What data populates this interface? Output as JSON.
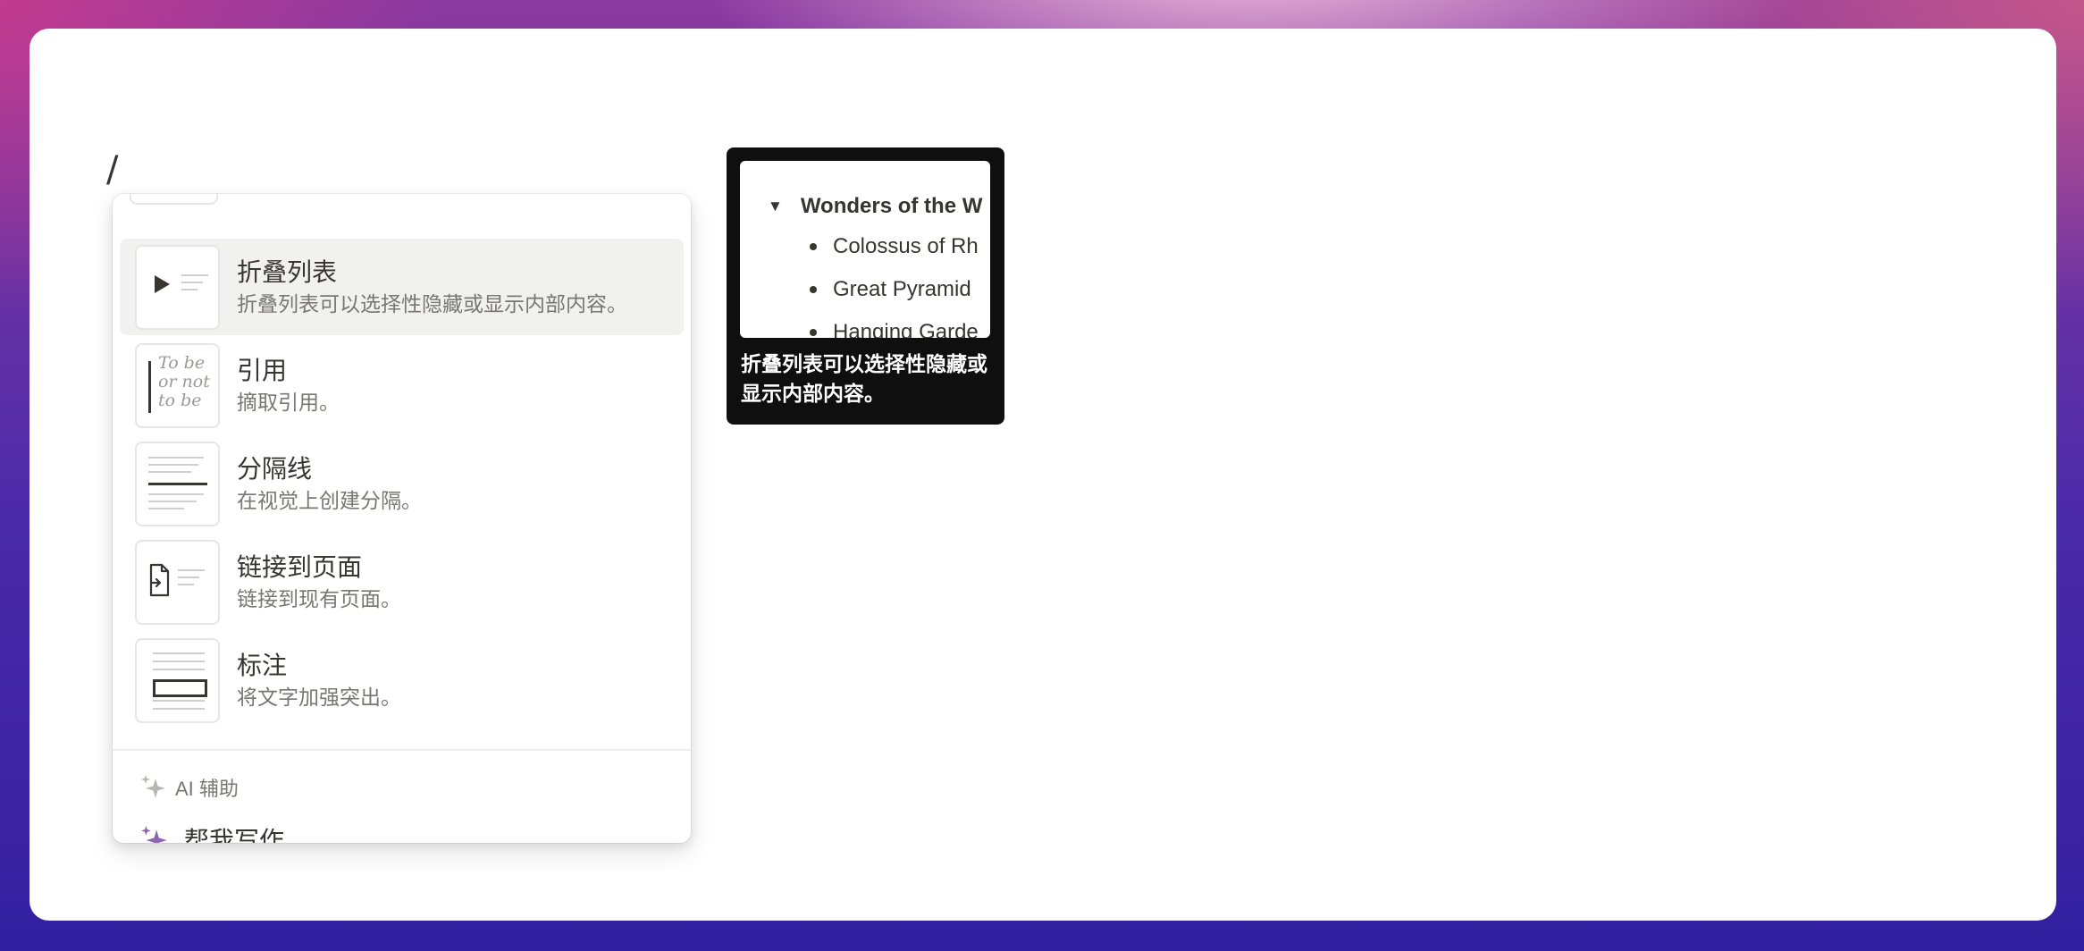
{
  "editor": {
    "typed_text": "/"
  },
  "menu": {
    "items": [
      {
        "title": "折叠列表",
        "description": "折叠列表可以选择性隐藏或显示内部内容。",
        "icon": "toggle-list-icon"
      },
      {
        "title": "引用",
        "description": "摘取引用。",
        "icon": "quote-icon",
        "thumb_text": [
          "To be",
          "or not",
          "to be"
        ]
      },
      {
        "title": "分隔线",
        "description": "在视觉上创建分隔。",
        "icon": "divider-icon"
      },
      {
        "title": "链接到页面",
        "description": "链接到现有页面。",
        "icon": "link-page-icon"
      },
      {
        "title": "标注",
        "description": "将文字加强突出。",
        "icon": "callout-icon"
      }
    ],
    "ai_section": {
      "header": "AI 辅助",
      "items": [
        {
          "label": "帮我写作",
          "icon": "sparkle-icon"
        }
      ]
    }
  },
  "tooltip": {
    "preview": {
      "toggle_title": "Wonders of the W",
      "bullets": [
        "Colossus of Rh",
        "Great Pyramid",
        "Hanging Garde"
      ]
    },
    "caption": "折叠列表可以选择性隐藏或显示内部内容。"
  },
  "colors": {
    "text": "#37352f",
    "muted": "#787774",
    "active_bg": "#f1f1ef",
    "ai_accent": "#9065b0",
    "tooltip_bg": "#0f0f0f"
  }
}
